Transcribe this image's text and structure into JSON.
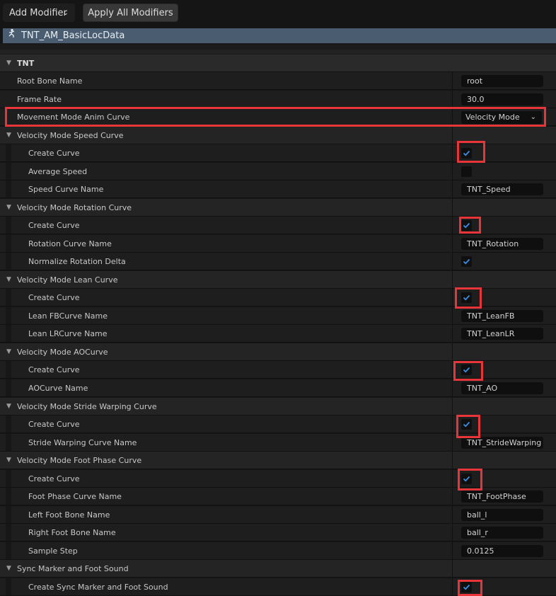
{
  "toolbar": {
    "add_modifier_label": "Add Modifier",
    "apply_all_label": "Apply All Modifiers"
  },
  "asset": {
    "name": "TNT_AM_BasicLocData",
    "icon": "animation-modifier-icon"
  },
  "category": {
    "label": "TNT"
  },
  "props": {
    "root_bone": {
      "label": "Root Bone Name",
      "value": "root"
    },
    "frame_rate": {
      "label": "Frame Rate",
      "value": "30.0"
    },
    "movement_mode": {
      "label": "Movement Mode Anim Curve",
      "value": "Velocity Mode"
    }
  },
  "groups": {
    "speed": {
      "label": "Velocity Mode Speed Curve",
      "create_curve": {
        "label": "Create Curve",
        "checked": true
      },
      "average_speed": {
        "label": "Average Speed",
        "checked": false
      },
      "curve_name": {
        "label": "Speed Curve Name",
        "value": "TNT_Speed"
      }
    },
    "rotation": {
      "label": "Velocity Mode Rotation Curve",
      "create_curve": {
        "label": "Create Curve",
        "checked": true
      },
      "curve_name": {
        "label": "Rotation Curve Name",
        "value": "TNT_Rotation"
      },
      "normalize": {
        "label": "Normalize Rotation Delta",
        "checked": true
      }
    },
    "lean": {
      "label": "Velocity Mode Lean Curve",
      "create_curve": {
        "label": "Create Curve",
        "checked": true
      },
      "fb_name": {
        "label": "Lean FBCurve Name",
        "value": "TNT_LeanFB"
      },
      "lr_name": {
        "label": "Lean LRCurve Name",
        "value": "TNT_LeanLR"
      }
    },
    "ao": {
      "label": "Velocity Mode AOCurve",
      "create_curve": {
        "label": "Create Curve",
        "checked": true
      },
      "curve_name": {
        "label": "AOCurve Name",
        "value": "TNT_AO"
      }
    },
    "stride": {
      "label": "Velocity Mode Stride Warping Curve",
      "create_curve": {
        "label": "Create Curve",
        "checked": true
      },
      "curve_name": {
        "label": "Stride Warping Curve Name",
        "value": "TNT_StrideWarping"
      }
    },
    "foot_phase": {
      "label": "Velocity Mode Foot Phase Curve",
      "create_curve": {
        "label": "Create Curve",
        "checked": true
      },
      "curve_name": {
        "label": "Foot Phase Curve Name",
        "value": "TNT_FootPhase"
      },
      "left_bone": {
        "label": "Left Foot Bone Name",
        "value": "ball_l"
      },
      "right_bone": {
        "label": "Right Foot Bone Name",
        "value": "ball_r"
      },
      "sample_step": {
        "label": "Sample Step",
        "value": "0.0125"
      }
    },
    "sync": {
      "label": "Sync Marker and Foot Sound",
      "create_sync": {
        "label": "Create Sync Marker and Foot Sound",
        "checked": true
      }
    }
  },
  "colors": {
    "highlight": "#e8353a",
    "check": "#3a8fe8",
    "asset_bar": "#4a5d70"
  }
}
